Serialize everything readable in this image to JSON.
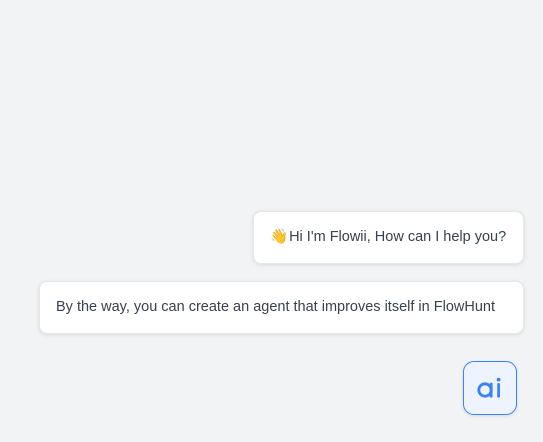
{
  "chat": {
    "messages": [
      {
        "emoji": "👋",
        "text": "Hi I'm Flowii, How can I help you?"
      },
      {
        "text": "By the way, you can create an agent that improves itself in FlowHunt"
      }
    ]
  },
  "launcher": {
    "icon": "ai-logo-icon",
    "accent_color": "#3b82f6",
    "background_color": "#eef4ff"
  },
  "colors": {
    "page_background": "#f2f3f5",
    "bubble_background": "#ffffff",
    "bubble_text": "#374151"
  }
}
